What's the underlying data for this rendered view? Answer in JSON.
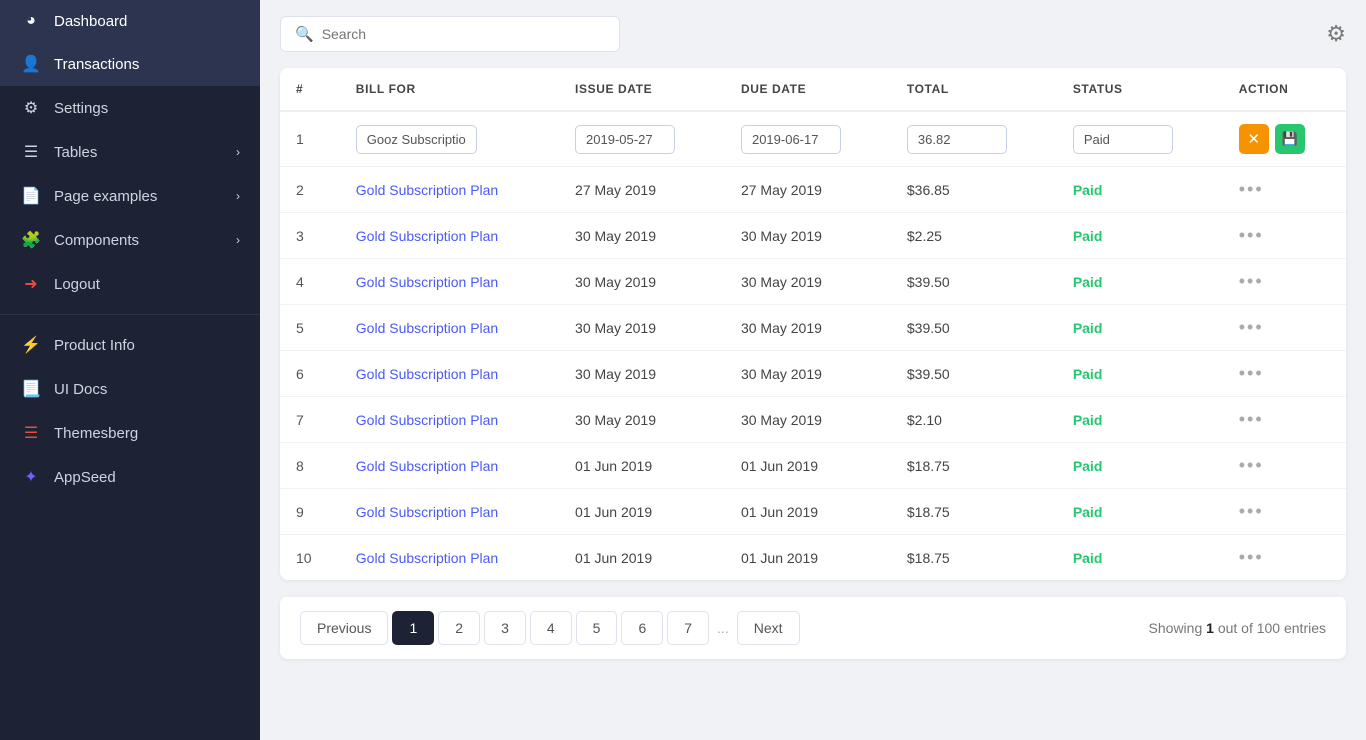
{
  "sidebar": {
    "items": [
      {
        "id": "dashboard",
        "label": "Dashboard",
        "icon": "pie-chart",
        "hasChevron": false,
        "active": false
      },
      {
        "id": "transactions",
        "label": "Transactions",
        "icon": "user-circle",
        "hasChevron": false,
        "active": true
      },
      {
        "id": "settings",
        "label": "Settings",
        "icon": "gear",
        "hasChevron": false,
        "active": false
      },
      {
        "id": "tables",
        "label": "Tables",
        "icon": "table",
        "hasChevron": true,
        "active": false
      },
      {
        "id": "page-examples",
        "label": "Page examples",
        "icon": "file",
        "hasChevron": true,
        "active": false
      },
      {
        "id": "components",
        "label": "Components",
        "icon": "puzzle",
        "hasChevron": true,
        "active": false
      },
      {
        "id": "logout",
        "label": "Logout",
        "icon": "logout",
        "hasChevron": false,
        "active": false
      }
    ],
    "bottom_items": [
      {
        "id": "product-info",
        "label": "Product Info",
        "icon": "bolt",
        "active": false
      },
      {
        "id": "ui-docs",
        "label": "UI Docs",
        "icon": "book",
        "active": false
      },
      {
        "id": "themesberg",
        "label": "Themesberg",
        "icon": "layers",
        "active": false
      },
      {
        "id": "appseed",
        "label": "AppSeed",
        "icon": "seedling",
        "active": false
      }
    ]
  },
  "search": {
    "placeholder": "Search"
  },
  "table": {
    "columns": [
      "#",
      "BILL FOR",
      "ISSUE DATE",
      "DUE DATE",
      "TOTAL",
      "STATUS",
      "ACTION"
    ],
    "row1_editable": {
      "num": "1",
      "bill_for": "Gooz Subscriptio",
      "issue_date": "2019-05-27",
      "due_date": "2019-06-17",
      "total": "36.82",
      "status": "Paid"
    },
    "rows": [
      {
        "num": 2,
        "bill_for": "Gold Subscription Plan",
        "issue_date": "27 May 2019",
        "due_date": "27 May 2019",
        "total": "$36.85",
        "status": "Paid"
      },
      {
        "num": 3,
        "bill_for": "Gold Subscription Plan",
        "issue_date": "30 May 2019",
        "due_date": "30 May 2019",
        "total": "$2.25",
        "status": "Paid"
      },
      {
        "num": 4,
        "bill_for": "Gold Subscription Plan",
        "issue_date": "30 May 2019",
        "due_date": "30 May 2019",
        "total": "$39.50",
        "status": "Paid"
      },
      {
        "num": 5,
        "bill_for": "Gold Subscription Plan",
        "issue_date": "30 May 2019",
        "due_date": "30 May 2019",
        "total": "$39.50",
        "status": "Paid"
      },
      {
        "num": 6,
        "bill_for": "Gold Subscription Plan",
        "issue_date": "30 May 2019",
        "due_date": "30 May 2019",
        "total": "$39.50",
        "status": "Paid"
      },
      {
        "num": 7,
        "bill_for": "Gold Subscription Plan",
        "issue_date": "30 May 2019",
        "due_date": "30 May 2019",
        "total": "$2.10",
        "status": "Paid"
      },
      {
        "num": 8,
        "bill_for": "Gold Subscription Plan",
        "issue_date": "01 Jun 2019",
        "due_date": "01 Jun 2019",
        "total": "$18.75",
        "status": "Paid"
      },
      {
        "num": 9,
        "bill_for": "Gold Subscription Plan",
        "issue_date": "01 Jun 2019",
        "due_date": "01 Jun 2019",
        "total": "$18.75",
        "status": "Paid"
      },
      {
        "num": 10,
        "bill_for": "Gold Subscription Plan",
        "issue_date": "01 Jun 2019",
        "due_date": "01 Jun 2019",
        "total": "$18.75",
        "status": "Paid"
      }
    ]
  },
  "pagination": {
    "previous_label": "Previous",
    "next_label": "Next",
    "pages": [
      "1",
      "2",
      "3",
      "4",
      "5",
      "6",
      "7"
    ],
    "active_page": "1",
    "ellipsis": "...",
    "showing_text": "Showing",
    "showing_bold": "1",
    "showing_suffix": "out of 100 entries"
  }
}
